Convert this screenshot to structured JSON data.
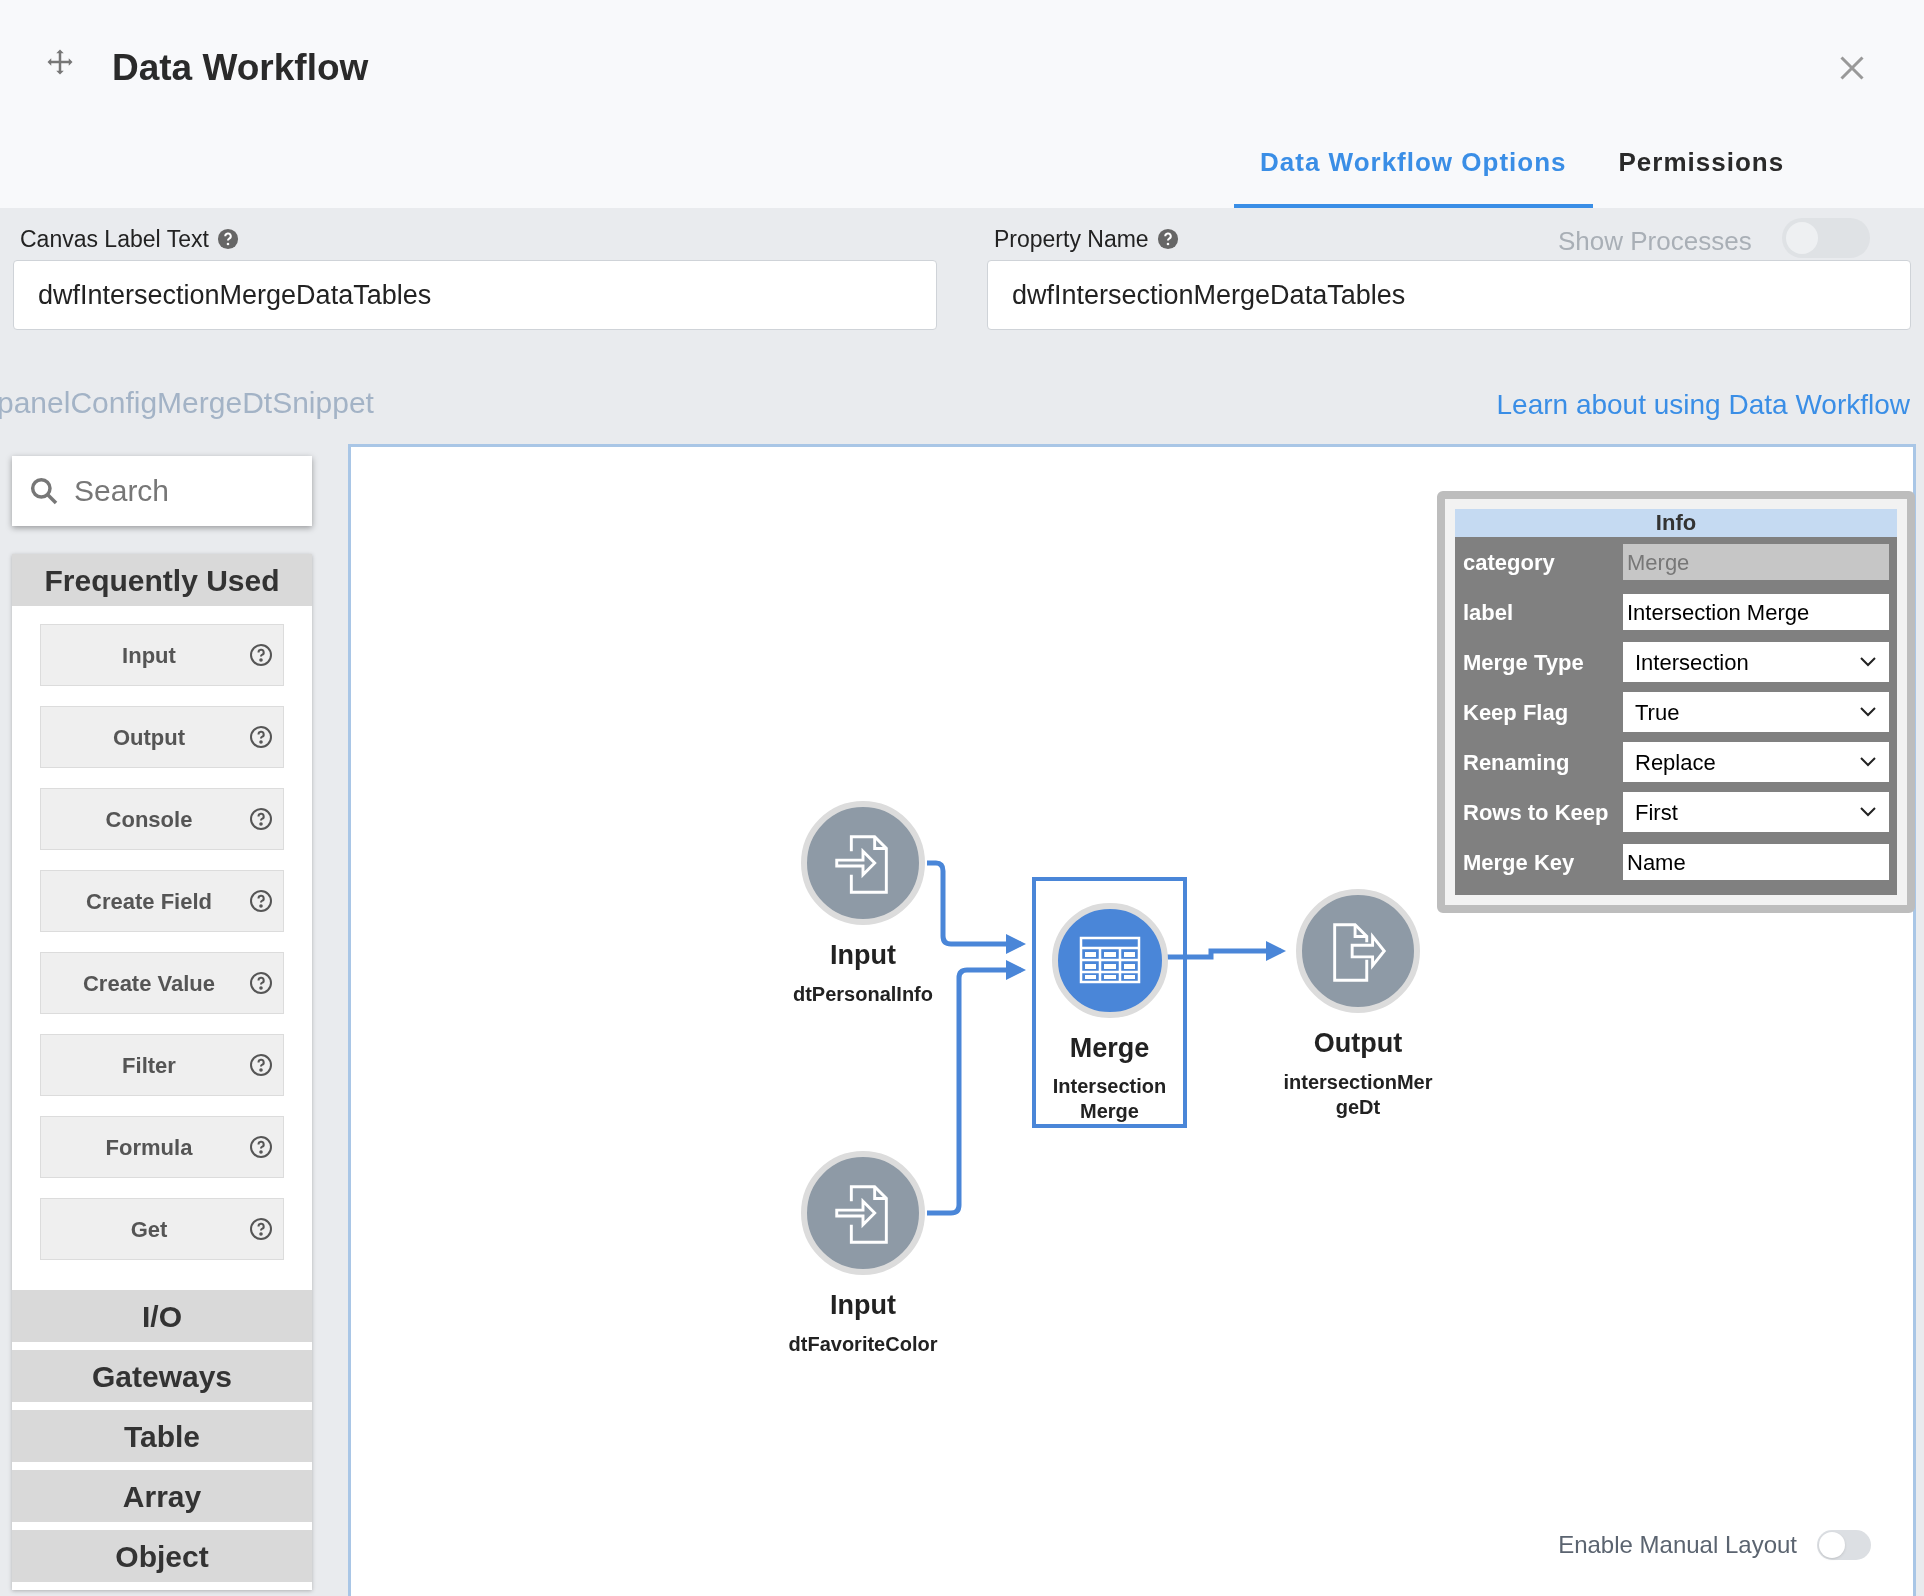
{
  "window": {
    "title": "Data Workflow"
  },
  "tabs": [
    {
      "label": "Data Workflow Options",
      "selected": true
    },
    {
      "label": "Permissions",
      "selected": false
    }
  ],
  "fields": [
    {
      "label": "Canvas Label Text",
      "value": "dwfIntersectionMergeDataTables"
    },
    {
      "label": "Property Name",
      "value": "dwfIntersectionMergeDataTables"
    }
  ],
  "background": {
    "snippet_label": "panelConfigMergeDtSnippet",
    "show_processes": {
      "label": "Show Processes",
      "on": false
    }
  },
  "learn_link": "Learn about using Data Workflow",
  "palette": {
    "search_placeholder": "Search",
    "sections": [
      {
        "title": "Frequently Used",
        "items": [
          "Input",
          "Output",
          "Console",
          "Create Field",
          "Create Value",
          "Filter",
          "Formula",
          "Get"
        ]
      },
      {
        "title": "I/O"
      },
      {
        "title": "Gateways"
      },
      {
        "title": "Table"
      },
      {
        "title": "Array"
      },
      {
        "title": "Object"
      }
    ]
  },
  "canvas": {
    "nodes": [
      {
        "kind": "input",
        "title": "Input",
        "subtitle": "dtPersonalInfo",
        "selected": false
      },
      {
        "kind": "input",
        "title": "Input",
        "subtitle": "dtFavoriteColor",
        "selected": false
      },
      {
        "kind": "merge",
        "title": "Merge",
        "subtitle": "Intersection Merge",
        "selected": true
      },
      {
        "kind": "output",
        "title": "Output",
        "subtitle": "intersectionMer geDt",
        "selected": false
      }
    ]
  },
  "info_panel": {
    "title": "Info",
    "rows": [
      {
        "kind": "readonly",
        "label": "category",
        "value": "Merge"
      },
      {
        "kind": "text",
        "label": "label",
        "value": "Intersection Merge"
      },
      {
        "kind": "select",
        "label": "Merge Type",
        "value": "Intersection"
      },
      {
        "kind": "select",
        "label": "Keep Flag",
        "value": "True"
      },
      {
        "kind": "select",
        "label": "Renaming",
        "value": "Replace"
      },
      {
        "kind": "select",
        "label": "Rows to Keep",
        "value": "First"
      },
      {
        "kind": "text",
        "label": "Merge Key",
        "value": "Name"
      }
    ]
  },
  "manual_layout": {
    "label": "Enable Manual Layout",
    "on": false
  }
}
